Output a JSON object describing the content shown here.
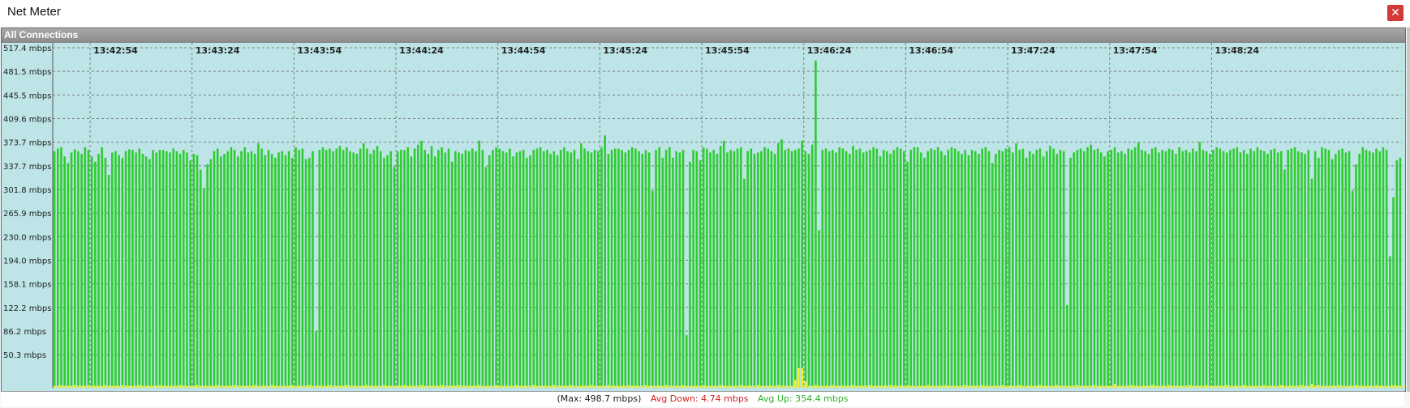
{
  "window": {
    "title": "Net Meter",
    "close_symbol": "✕"
  },
  "graph": {
    "header_label": "All Connections"
  },
  "status": {
    "max_text": "(Max: 498.7 mbps)",
    "avg_down_text": "Avg Down: 4.74 mbps",
    "avg_up_text": "Avg Up: 354.4 mbps"
  },
  "colors": {
    "background": "#bde4e6",
    "upload": "#2fcc2f",
    "download": "#f0f020",
    "grid": "#6a6a6a",
    "avg_down": "#d42020",
    "avg_up": "#2cb02c"
  },
  "chart_data": {
    "type": "bar",
    "title": "",
    "xlabel": "",
    "ylabel": "",
    "ylim": [
      0,
      517.4
    ],
    "yticks": [
      "517.4 mbps",
      "481.5 mbps",
      "445.5 mbps",
      "409.6 mbps",
      "373.7 mbps",
      "337.7 mbps",
      "301.8 mbps",
      "265.9 mbps",
      "230.0 mbps",
      "194.0 mbps",
      "158.1 mbps",
      "122.2 mbps",
      "86.2 mbps",
      "50.3 mbps"
    ],
    "ytick_values": [
      517.4,
      481.5,
      445.5,
      409.6,
      373.7,
      337.7,
      301.8,
      265.9,
      230.0,
      194.0,
      158.1,
      122.2,
      86.2,
      50.3
    ],
    "xticks": [
      "13:42:54",
      "13:43:24",
      "13:43:54",
      "13:44:24",
      "13:44:54",
      "13:45:24",
      "13:45:54",
      "13:46:24",
      "13:46:54",
      "13:47:24",
      "13:47:54",
      "13:48:24"
    ],
    "x_start": "13:42:43",
    "sample_interval_s": 1,
    "grid": true,
    "series": [
      {
        "name": "Avg Up",
        "color": "#2fcc2f",
        "values": [
          360,
          364,
          366,
          352,
          342,
          358,
          363,
          360,
          356,
          366,
          362,
          352,
          344,
          356,
          366,
          350,
          324,
          358,
          360,
          354,
          350,
          360,
          363,
          362,
          358,
          364,
          356,
          352,
          348,
          362,
          358,
          362,
          362,
          360,
          358,
          364,
          360,
          356,
          362,
          358,
          346,
          356,
          354,
          332,
          304,
          340,
          348,
          360,
          364,
          352,
          356,
          360,
          366,
          362,
          352,
          360,
          366,
          358,
          360,
          356,
          372,
          364,
          354,
          362,
          356,
          350,
          358,
          360,
          354,
          360,
          350,
          366,
          362,
          364,
          348,
          350,
          360,
          86,
          362,
          366,
          362,
          364,
          360,
          364,
          368,
          362,
          366,
          360,
          358,
          356,
          364,
          372,
          364,
          356,
          362,
          368,
          360,
          350,
          354,
          360,
          336,
          360,
          362,
          362,
          366,
          352,
          364,
          370,
          376,
          362,
          356,
          368,
          352,
          362,
          366,
          358,
          364,
          344,
          360,
          358,
          356,
          362,
          360,
          364,
          360,
          376,
          362,
          336,
          354,
          362,
          366,
          364,
          360,
          358,
          364,
          352,
          358,
          360,
          362,
          350,
          354,
          362,
          364,
          366,
          360,
          362,
          356,
          360,
          354,
          362,
          366,
          360,
          358,
          362,
          348,
          372,
          364,
          360,
          358,
          362,
          360,
          366,
          384,
          356,
          362,
          364,
          364,
          362,
          358,
          362,
          366,
          364,
          360,
          356,
          362,
          358,
          300,
          362,
          366,
          350,
          362,
          366,
          350,
          360,
          358,
          362,
          80,
          344,
          362,
          360,
          346,
          366,
          364,
          358,
          362,
          356,
          368,
          376,
          358,
          362,
          360,
          364,
          366,
          318,
          360,
          364,
          356,
          358,
          360,
          366,
          364,
          360,
          356,
          372,
          378,
          362,
          364,
          360,
          362,
          364,
          376,
          360,
          356,
          370,
          498,
          240,
          362,
          364,
          360,
          362,
          358,
          366,
          364,
          360,
          356,
          368,
          362,
          364,
          358,
          360,
          362,
          366,
          364,
          352,
          362,
          360,
          356,
          362,
          366,
          364,
          360,
          344,
          362,
          366,
          366,
          358,
          350,
          360,
          364,
          362,
          366,
          360,
          354,
          362,
          366,
          364,
          360,
          356,
          362,
          354,
          362,
          360,
          356,
          364,
          366,
          360,
          342,
          356,
          362,
          360,
          364,
          366,
          358,
          372,
          362,
          364,
          350,
          360,
          356,
          362,
          364,
          352,
          360,
          368,
          364,
          356,
          362,
          360,
          126,
          350,
          358,
          362,
          364,
          360,
          366,
          370,
          362,
          364,
          358,
          352,
          360,
          362,
          366,
          358,
          360,
          356,
          364,
          362,
          366,
          374,
          362,
          360,
          356,
          364,
          366,
          358,
          362,
          360,
          364,
          362,
          356,
          366,
          360,
          362,
          358,
          364,
          360,
          374,
          362,
          360,
          356,
          362,
          366,
          364,
          360,
          358,
          362,
          364,
          366,
          358,
          362,
          356,
          364,
          360,
          366,
          362,
          360,
          356,
          362,
          364,
          358,
          360,
          332,
          362,
          364,
          366,
          360,
          358,
          356,
          362,
          318,
          360,
          350,
          366,
          364,
          362,
          348,
          356,
          362,
          364,
          358,
          360,
          300,
          340,
          356,
          366,
          362,
          360,
          358,
          364,
          360,
          366,
          362,
          200,
          290,
          346,
          350
        ]
      },
      {
        "name": "Avg Down",
        "color": "#f0f020",
        "values": [
          3,
          3,
          4,
          3,
          3,
          3,
          4,
          3,
          3,
          3,
          4,
          3,
          3,
          3,
          3,
          4,
          3,
          3,
          3,
          3,
          4,
          3,
          3,
          3,
          3,
          4,
          3,
          3,
          3,
          3,
          3,
          4,
          3,
          3,
          3,
          3,
          3,
          4,
          3,
          3,
          3,
          3,
          4,
          3,
          3,
          3,
          3,
          3,
          4,
          3,
          3,
          3,
          3,
          4,
          3,
          3,
          3,
          3,
          3,
          4,
          3,
          3,
          3,
          3,
          4,
          3,
          3,
          3,
          3,
          3,
          4,
          3,
          3,
          3,
          3,
          4,
          3,
          3,
          3,
          3,
          3,
          4,
          3,
          3,
          3,
          3,
          4,
          3,
          3,
          3,
          3,
          3,
          4,
          3,
          3,
          3,
          3,
          4,
          3,
          3,
          3,
          3,
          3,
          4,
          3,
          3,
          3,
          3,
          4,
          3,
          3,
          3,
          3,
          3,
          4,
          3,
          3,
          3,
          3,
          4,
          3,
          3,
          3,
          3,
          3,
          4,
          3,
          3,
          3,
          3,
          4,
          3,
          3,
          3,
          3,
          3,
          4,
          3,
          3,
          3,
          3,
          4,
          3,
          3,
          3,
          3,
          3,
          4,
          3,
          3,
          3,
          3,
          4,
          3,
          3,
          3,
          3,
          3,
          4,
          3,
          3,
          3,
          3,
          4,
          3,
          3,
          3,
          3,
          3,
          4,
          3,
          3,
          3,
          3,
          4,
          3,
          3,
          3,
          3,
          3,
          4,
          3,
          3,
          3,
          3,
          4,
          3,
          3,
          3,
          3,
          3,
          4,
          3,
          3,
          3,
          3,
          4,
          3,
          3,
          3,
          3,
          3,
          4,
          3,
          3,
          3,
          3,
          4,
          3,
          3,
          3,
          3,
          3,
          4,
          3,
          3,
          3,
          3,
          4,
          3,
          3,
          3,
          3,
          3,
          4,
          3,
          3,
          3,
          3,
          4,
          3,
          3,
          3,
          3,
          3,
          4,
          3,
          3,
          3,
          3,
          4,
          3,
          3,
          3,
          3,
          3,
          4,
          3,
          3,
          3,
          3,
          4,
          3,
          3,
          3,
          3,
          3,
          4,
          3,
          3,
          3,
          3,
          4,
          3,
          3,
          3,
          3,
          3,
          4,
          3,
          3,
          3,
          3,
          4,
          3,
          3,
          3,
          3,
          3,
          4,
          3,
          3,
          3,
          3,
          4,
          3,
          3,
          3,
          3,
          3,
          4,
          3,
          3,
          3,
          3,
          4,
          3,
          3,
          3,
          3,
          3,
          4,
          3,
          3,
          3,
          3,
          4,
          3,
          3,
          3,
          3,
          3,
          4,
          3,
          3,
          3,
          3,
          4,
          3,
          3,
          3,
          3,
          3,
          4,
          3,
          3,
          3,
          3,
          4,
          3,
          3,
          3,
          3,
          3,
          4,
          3,
          3,
          3,
          3,
          4,
          3,
          3,
          3,
          3,
          3,
          4,
          3,
          3,
          3,
          3,
          4,
          3,
          3,
          3,
          3,
          3,
          4,
          3,
          3,
          3,
          3,
          4,
          3,
          3,
          3,
          3,
          3,
          4,
          3,
          3,
          3,
          3,
          4,
          3,
          3,
          3,
          3,
          3,
          4,
          3,
          3,
          3,
          3,
          4,
          3,
          3,
          3,
          3,
          3,
          4,
          3,
          3,
          3,
          3,
          4,
          3,
          3,
          3,
          3,
          3,
          4,
          3,
          3,
          3,
          3,
          4,
          3,
          3,
          3,
          3,
          3,
          4,
          3,
          3,
          3,
          3,
          4,
          3,
          3,
          3,
          3,
          3,
          4,
          3,
          3,
          3,
          3,
          4,
          3,
          3,
          3,
          3,
          3,
          4,
          3,
          3,
          3,
          3,
          4,
          3,
          3,
          3
        ],
        "highlights": [
          [
            218,
            12
          ],
          [
            219,
            30
          ],
          [
            220,
            30
          ],
          [
            221,
            10
          ],
          [
            312,
            6
          ],
          [
            370,
            6
          ]
        ]
      }
    ]
  }
}
